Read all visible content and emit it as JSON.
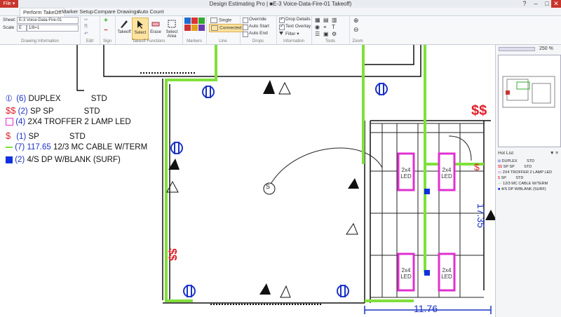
{
  "window": {
    "title": "Design Estimating Pro | ■E-3 Voice-Data-Fire-01 Takeoff)",
    "file_label": "File ▾"
  },
  "tabs": [
    "Perform TakeOff",
    "Marker Setup",
    "Compare Drawings",
    "Auto Count"
  ],
  "ribbon": {
    "sheet_label": "Sheet:",
    "sheet_value": "E-3 Voice-Data-Fire-01",
    "scale_label": "Scale",
    "scale_unit": "E",
    "scale_value": "1/8=1",
    "groups": [
      "Drawing Information",
      "Edit",
      "Sign",
      "Takeoff Functions",
      "Markers",
      "Line",
      "Drops",
      "Information",
      "Tools",
      "Zoom"
    ],
    "takeoff_buttons": [
      "Takeoff",
      "Select",
      "Erase",
      "Select Area"
    ],
    "line_options": [
      "Single",
      "Connected"
    ],
    "drops_options": [
      "Override",
      "Auto Start",
      "Auto End"
    ],
    "info_options": [
      "Drop Details",
      "Text Overlay",
      "Filter"
    ]
  },
  "legend": [
    {
      "count": "(6)",
      "name": "DUPLEX",
      "std": "STD"
    },
    {
      "count": "(2)",
      "name": "SP SP",
      "std": "STD"
    },
    {
      "count": "(4)",
      "name": "2X4 TROFFER 2 LAMP LED",
      "std": ""
    },
    {
      "count": "(1)",
      "name": "SP",
      "std": "STD"
    },
    {
      "count": "(7) 117.65",
      "name": "12/3 MC CABLE W/TERM",
      "std": ""
    },
    {
      "count": "(2)",
      "name": "4/S DP W/BLANK (SURF)",
      "std": ""
    }
  ],
  "drawing": {
    "led_label": "2x4 LED",
    "sp_symbol": "$$",
    "single_sp": "$",
    "s_label": "S",
    "dim_horizontal": "11.76",
    "dim_vertical": "17.35"
  },
  "panel": {
    "zoom": "250 %",
    "hotlist_title": "Hot List",
    "hotlist": [
      {
        "name": "DUPLEX",
        "std": "STD"
      },
      {
        "name": "SP SP",
        "std": "STD"
      },
      {
        "name": "2X4 TROFFER 2 LAMP LED",
        "std": ""
      },
      {
        "name": "SP",
        "std": "STD"
      },
      {
        "name": "12/3 MC CABLE W/TERM",
        "std": ""
      },
      {
        "name": "4/S DP W/BLANK (SURF)",
        "std": ""
      }
    ]
  },
  "colors": {
    "cable": "#7fe03a",
    "count_blue": "#1a32c8",
    "sp_red": "#e0202a",
    "troffer": "#e030d0",
    "dp_blue": "#1030e0"
  }
}
